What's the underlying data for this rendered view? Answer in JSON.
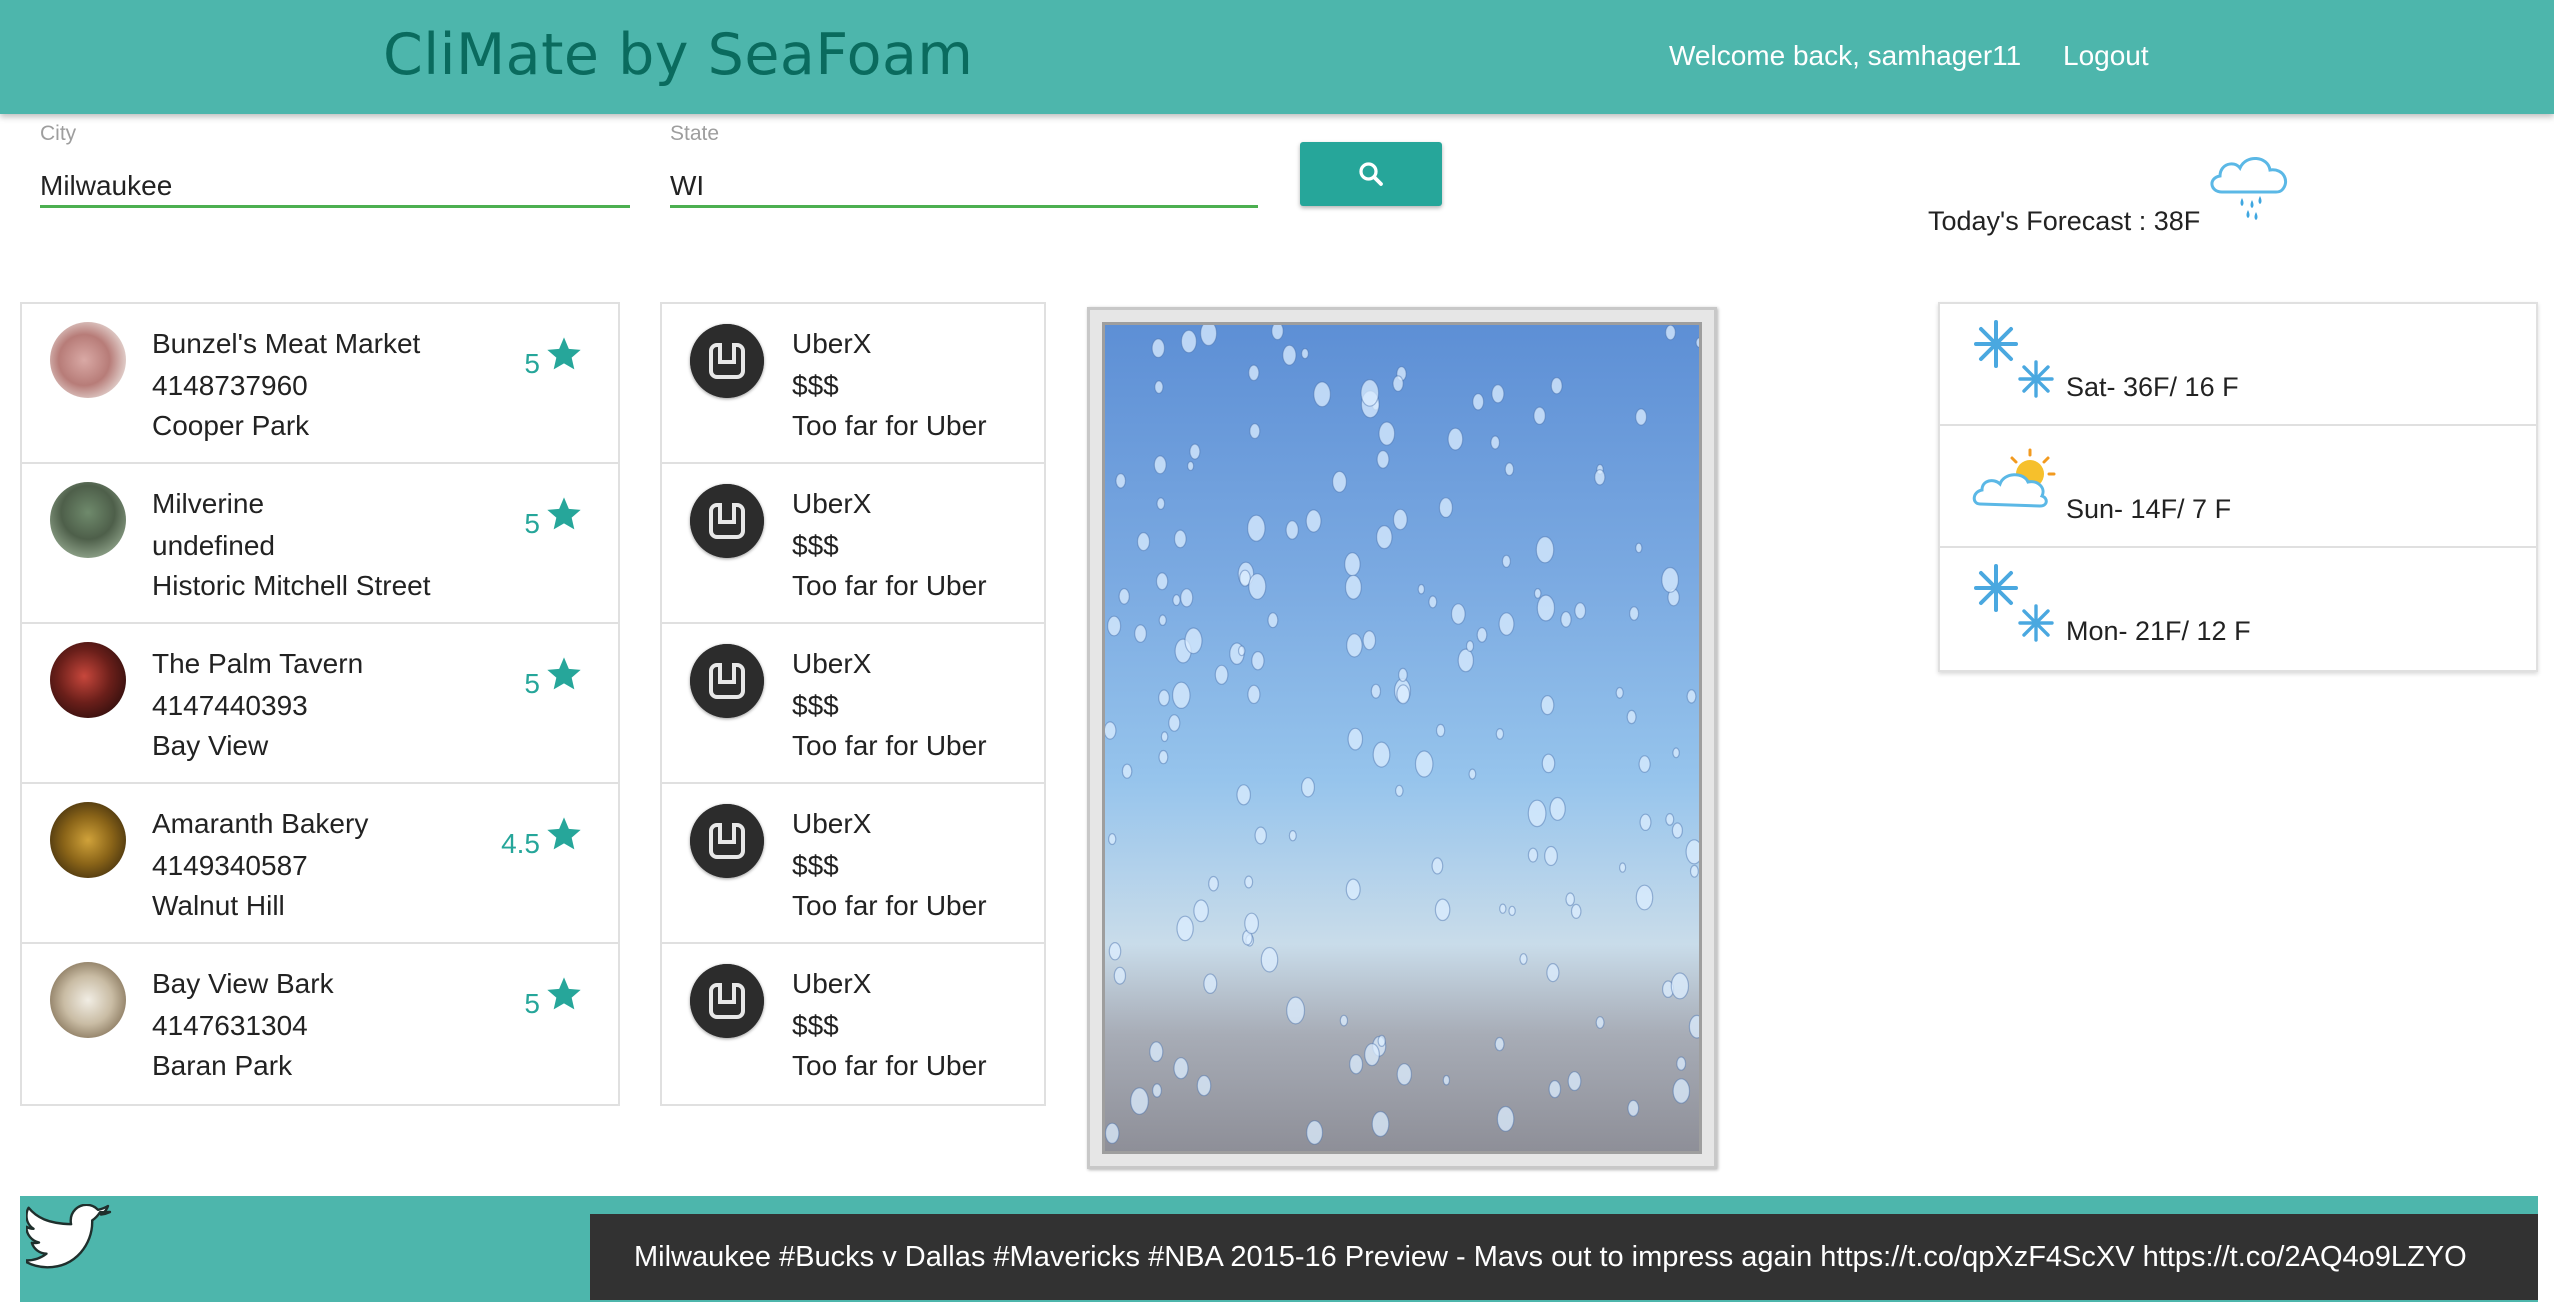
{
  "header": {
    "brand": "CliMate by SeaFoam",
    "welcome": "Welcome back, samhager11",
    "logout": "Logout"
  },
  "search": {
    "city_label": "City",
    "city_value": "Milwaukee",
    "state_label": "State",
    "state_value": "WI",
    "button_icon": "search-icon"
  },
  "today": {
    "text": "Today's Forecast : 38F",
    "icon": "rain-cloud-icon"
  },
  "places": [
    {
      "name": "Bunzel's Meat Market",
      "phone": "4148737960",
      "area": "Cooper Park",
      "rating": "5"
    },
    {
      "name": "Milverine",
      "phone": "undefined",
      "area": "Historic Mitchell Street",
      "rating": "5"
    },
    {
      "name": "The Palm Tavern",
      "phone": "4147440393",
      "area": "Bay View",
      "rating": "5"
    },
    {
      "name": "Amaranth Bakery",
      "phone": "4149340587",
      "area": "Walnut Hill",
      "rating": "4.5"
    },
    {
      "name": "Bay View Bark",
      "phone": "4147631304",
      "area": "Baran Park",
      "rating": "5"
    }
  ],
  "rides": [
    {
      "name": "UberX",
      "price": "$$$",
      "note": "Too far for Uber"
    },
    {
      "name": "UberX",
      "price": "$$$",
      "note": "Too far for Uber"
    },
    {
      "name": "UberX",
      "price": "$$$",
      "note": "Too far for Uber"
    },
    {
      "name": "UberX",
      "price": "$$$",
      "note": "Too far for Uber"
    },
    {
      "name": "UberX",
      "price": "$$$",
      "note": "Too far for Uber"
    }
  ],
  "forecast": [
    {
      "text": "Sat- 36F/ 16 F",
      "icon": "snowflake-icon"
    },
    {
      "text": "Sun- 14F/ 7 F",
      "icon": "partly-cloudy-icon"
    },
    {
      "text": "Mon- 21F/ 12 F",
      "icon": "snowflake-icon"
    }
  ],
  "footer": {
    "tweet": "Milwaukee #Bucks v Dallas #Mavericks #NBA 2015-16 Preview - Mavs out to impress again https://t.co/qpXzF4ScXV https://t.co/2AQ4o9LZYO"
  },
  "colors": {
    "header": "#4db6ac",
    "brand": "#0a6b5e",
    "accent": "#26a69a",
    "input_underline": "#4caf50",
    "tweet_bg": "#323232"
  }
}
